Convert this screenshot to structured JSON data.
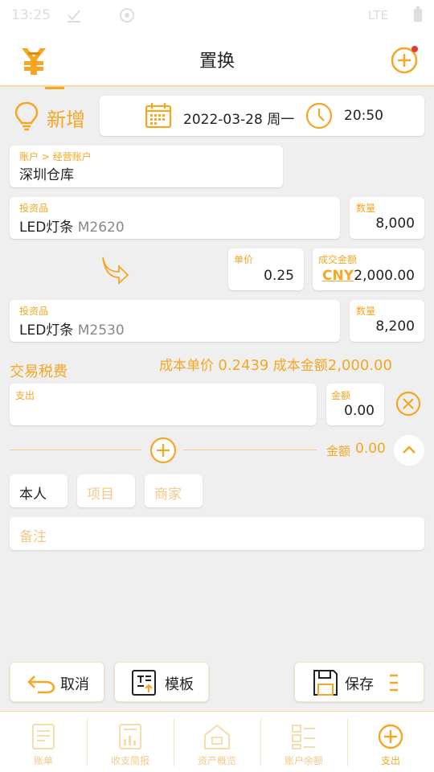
{
  "status": {
    "time": "13:25",
    "network": "LTE"
  },
  "header": {
    "title": "置换"
  },
  "mode": {
    "label": "新增"
  },
  "datetime": {
    "date": "2022-03-28 周一",
    "time": "20:50"
  },
  "account": {
    "label": "账户 > 经营账户",
    "value": "深圳仓库"
  },
  "source_item": {
    "label": "投资品",
    "name": "LED灯条",
    "code": "M2620",
    "qty_label": "数量",
    "qty": "8,000"
  },
  "price": {
    "label": "单价",
    "value": "0.25"
  },
  "amount": {
    "label": "成交金额",
    "currency": "CNY",
    "value": "2,000.00"
  },
  "target_item": {
    "label": "投资品",
    "name": "LED灯条",
    "code": "M2530",
    "qty_label": "数量",
    "qty": "8,200"
  },
  "tax": {
    "title": "交易税费",
    "unit_cost_label": "成本单价",
    "unit_cost": "0.2439",
    "cost_amount_label": "成本金额",
    "cost_amount": "2,000.00",
    "expense_label": "支出",
    "amount_label": "金额",
    "amount": "0.00"
  },
  "total": {
    "label": "金额",
    "value": "0.00"
  },
  "tags": {
    "person": "本人",
    "project": "项目",
    "merchant": "商家"
  },
  "note": {
    "placeholder": "备注"
  },
  "actions": {
    "cancel": "取消",
    "template": "模板",
    "save": "保存"
  },
  "tabs": [
    "账单",
    "收支简报",
    "资产概览",
    "账户余额",
    "支出"
  ],
  "colors": {
    "accent": "#f5a623",
    "link": "#1e6fd9",
    "danger": "#e53935"
  }
}
